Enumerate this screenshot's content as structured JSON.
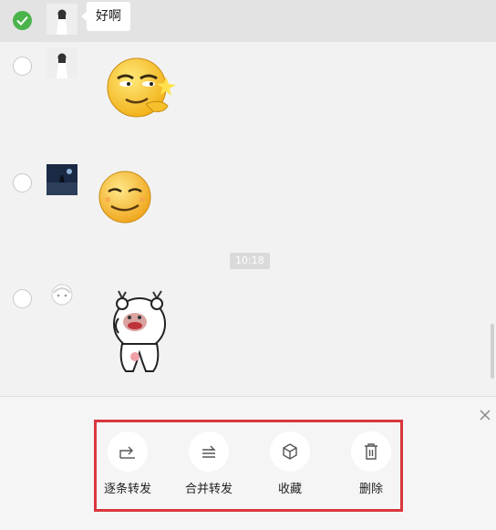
{
  "messages": [
    {
      "text": "好啊",
      "selected": true
    },
    {
      "sticker": "smirk-emoji"
    },
    {
      "sticker": "grin-emoji"
    },
    {
      "sticker": "bear-sticker"
    }
  ],
  "timestamp": "10:18",
  "toolbar": {
    "actions": [
      {
        "label": "逐条转发",
        "icon": "forward-icon"
      },
      {
        "label": "合并转发",
        "icon": "merge-forward-icon"
      },
      {
        "label": "收藏",
        "icon": "favorite-box-icon"
      },
      {
        "label": "删除",
        "icon": "trash-icon"
      }
    ]
  },
  "colors": {
    "check_green": "#4bb34b",
    "highlight_red": "#d9363e",
    "background": "#f2f2f2"
  }
}
